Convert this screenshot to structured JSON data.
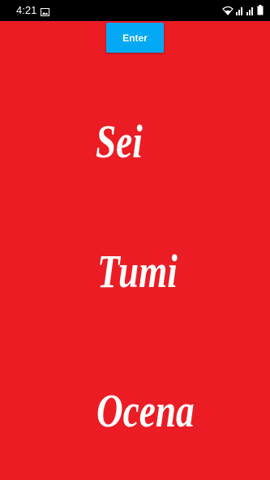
{
  "status_bar": {
    "time": "4:21",
    "icons": [
      "image-icon",
      "wifi-icon",
      "signal-icon",
      "signal-icon",
      "battery-icon"
    ]
  },
  "toolbar": {
    "enter_label": "Enter"
  },
  "colors": {
    "background": "#ec1c24",
    "button": "#03a9f4",
    "text": "#ffffff"
  },
  "words": [
    "Sei",
    "Tumi",
    "Ocena"
  ]
}
